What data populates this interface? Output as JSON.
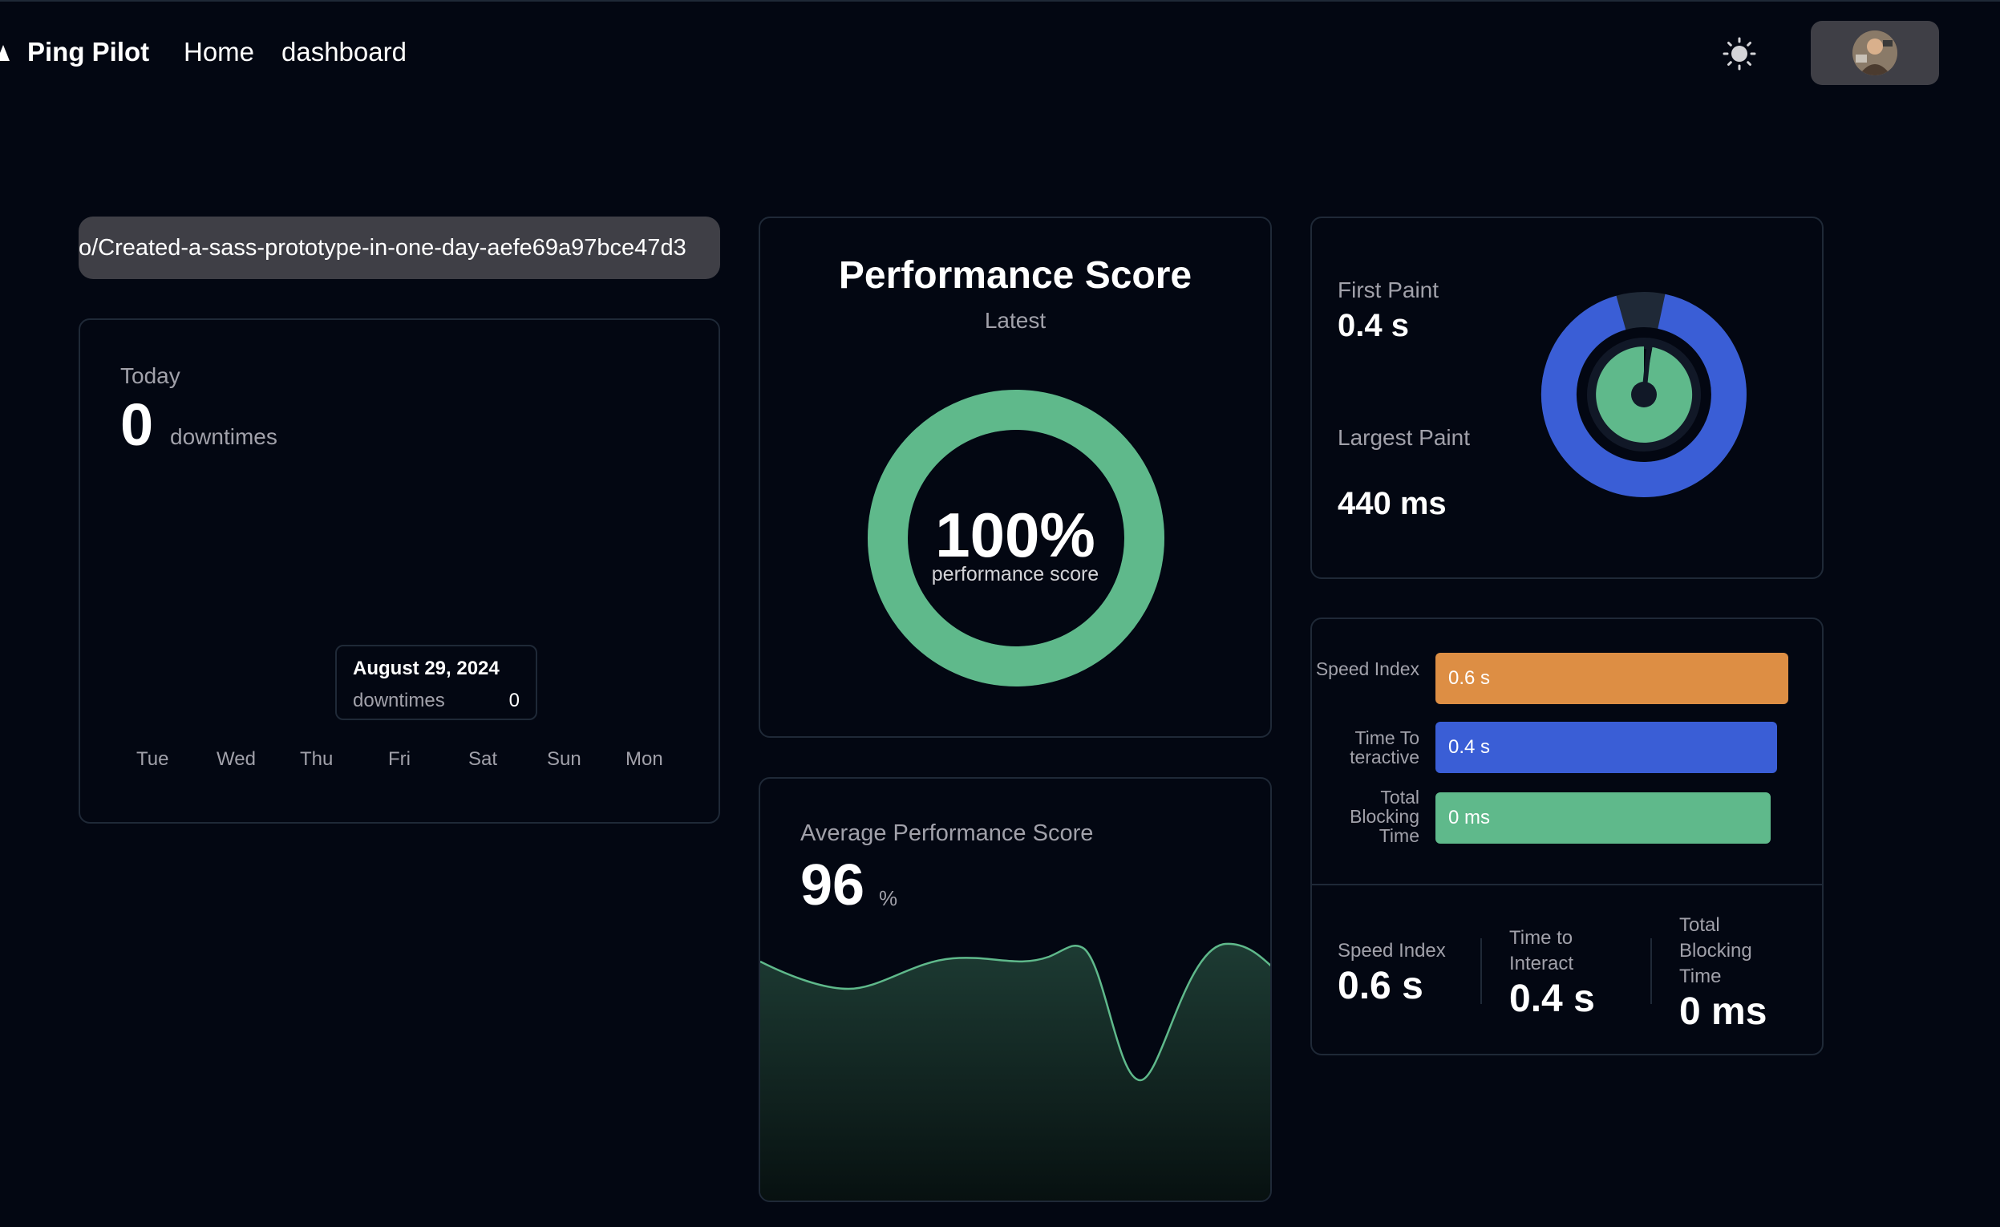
{
  "nav": {
    "brand": "Ping Pilot",
    "links": [
      "Home",
      "dashboard"
    ],
    "theme_icon": "sun-icon",
    "avatar_icon": "user-avatar"
  },
  "url": {
    "value": "o/Created-a-sass-prototype-in-one-day-aefe69a97bce47d3"
  },
  "downtime": {
    "label": "Today",
    "count": "0",
    "unit": "downtimes",
    "tooltip": {
      "date": "August 29, 2024",
      "label": "downtimes",
      "value": "0"
    },
    "days": [
      "Tue",
      "Wed",
      "Thu",
      "Fri",
      "Sat",
      "Sun",
      "Mon"
    ]
  },
  "performance": {
    "title": "Performance Score",
    "subtitle": "Latest",
    "value": "100%",
    "value_label": "performance score",
    "score_fraction": 1.0
  },
  "average": {
    "label": "Average Performance Score",
    "value": "96",
    "unit": "%"
  },
  "paint": {
    "first_label": "First Paint",
    "first_value": "0.4 s",
    "largest_label": "Largest Paint",
    "largest_value": "440 ms"
  },
  "metrics": {
    "bars": [
      {
        "label": "Speed Index",
        "value": "0.6 s",
        "fraction": 1.0,
        "color": "#dd8e44"
      },
      {
        "label": "Time To teractive",
        "value": "0.4 s",
        "fraction": 0.968,
        "color": "#3a5ed6"
      },
      {
        "label": "Total Blocking Time",
        "value": "0 ms",
        "fraction": 0.95,
        "color": "#5fb98b"
      }
    ],
    "summary": [
      {
        "label": "Speed Index",
        "value": "0.6 s"
      },
      {
        "label": "Time to Interact",
        "value": "0.4 s"
      },
      {
        "label": "Total Blocking Time",
        "value": "0 ms"
      }
    ]
  },
  "colors": {
    "background": "#030712",
    "green": "#5fb98b",
    "blue": "#3a5ed6",
    "orange": "#dd8e44",
    "pill": "#3f3f46"
  }
}
